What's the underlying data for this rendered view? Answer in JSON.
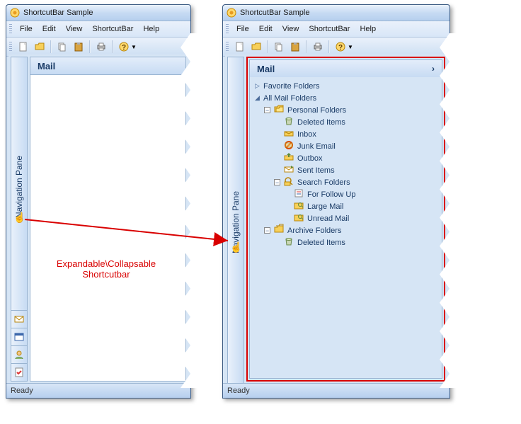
{
  "app": {
    "title": "ShortcutBar Sample",
    "status": "Ready"
  },
  "menu": {
    "items": [
      "File",
      "Edit",
      "View",
      "ShortcutBar",
      "Help"
    ]
  },
  "navpane_label": "Navigation Pane",
  "mail_header": "Mail",
  "annotation": "Expandable\\Collapsable Shortcutbar",
  "tree": {
    "favorites": "Favorite Folders",
    "allmail": "All Mail Folders",
    "nodes": [
      {
        "label": "Personal Folders",
        "indent": 1,
        "icon": "folders",
        "exp": "minus"
      },
      {
        "label": "Deleted Items",
        "indent": 2,
        "icon": "trash"
      },
      {
        "label": "Inbox",
        "indent": 2,
        "icon": "inbox"
      },
      {
        "label": "Junk Email",
        "indent": 2,
        "icon": "junk"
      },
      {
        "label": "Outbox",
        "indent": 2,
        "icon": "outbox"
      },
      {
        "label": "Sent Items",
        "indent": 2,
        "icon": "sent"
      },
      {
        "label": "Search Folders",
        "indent": 2,
        "icon": "search",
        "exp": "minus"
      },
      {
        "label": "For Follow Up",
        "indent": 3,
        "icon": "followup"
      },
      {
        "label": "Large Mail",
        "indent": 3,
        "icon": "searchfolder"
      },
      {
        "label": "Unread Mail",
        "indent": 3,
        "icon": "searchfolder"
      },
      {
        "label": "Archive Folders",
        "indent": 1,
        "icon": "archive",
        "exp": "minus"
      },
      {
        "label": "Deleted Items",
        "indent": 2,
        "icon": "trash"
      }
    ]
  }
}
